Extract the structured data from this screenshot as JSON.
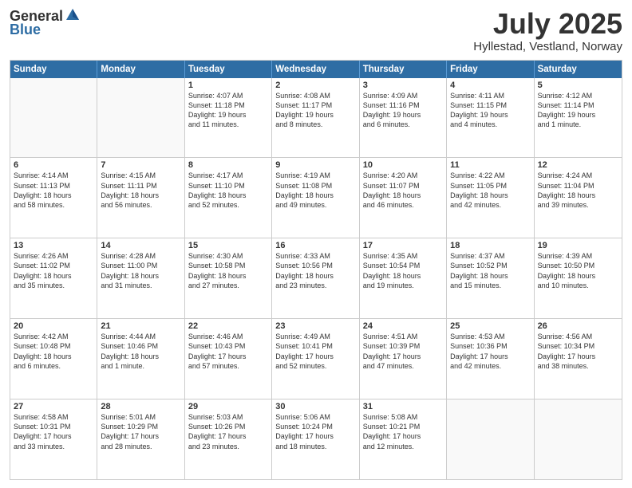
{
  "header": {
    "logo_line1": "General",
    "logo_line2": "Blue",
    "month": "July 2025",
    "location": "Hyllestad, Vestland, Norway"
  },
  "weekdays": [
    "Sunday",
    "Monday",
    "Tuesday",
    "Wednesday",
    "Thursday",
    "Friday",
    "Saturday"
  ],
  "rows": [
    [
      {
        "day": "",
        "text": ""
      },
      {
        "day": "",
        "text": ""
      },
      {
        "day": "1",
        "text": "Sunrise: 4:07 AM\nSunset: 11:18 PM\nDaylight: 19 hours\nand 11 minutes."
      },
      {
        "day": "2",
        "text": "Sunrise: 4:08 AM\nSunset: 11:17 PM\nDaylight: 19 hours\nand 8 minutes."
      },
      {
        "day": "3",
        "text": "Sunrise: 4:09 AM\nSunset: 11:16 PM\nDaylight: 19 hours\nand 6 minutes."
      },
      {
        "day": "4",
        "text": "Sunrise: 4:11 AM\nSunset: 11:15 PM\nDaylight: 19 hours\nand 4 minutes."
      },
      {
        "day": "5",
        "text": "Sunrise: 4:12 AM\nSunset: 11:14 PM\nDaylight: 19 hours\nand 1 minute."
      }
    ],
    [
      {
        "day": "6",
        "text": "Sunrise: 4:14 AM\nSunset: 11:13 PM\nDaylight: 18 hours\nand 58 minutes."
      },
      {
        "day": "7",
        "text": "Sunrise: 4:15 AM\nSunset: 11:11 PM\nDaylight: 18 hours\nand 56 minutes."
      },
      {
        "day": "8",
        "text": "Sunrise: 4:17 AM\nSunset: 11:10 PM\nDaylight: 18 hours\nand 52 minutes."
      },
      {
        "day": "9",
        "text": "Sunrise: 4:19 AM\nSunset: 11:08 PM\nDaylight: 18 hours\nand 49 minutes."
      },
      {
        "day": "10",
        "text": "Sunrise: 4:20 AM\nSunset: 11:07 PM\nDaylight: 18 hours\nand 46 minutes."
      },
      {
        "day": "11",
        "text": "Sunrise: 4:22 AM\nSunset: 11:05 PM\nDaylight: 18 hours\nand 42 minutes."
      },
      {
        "day": "12",
        "text": "Sunrise: 4:24 AM\nSunset: 11:04 PM\nDaylight: 18 hours\nand 39 minutes."
      }
    ],
    [
      {
        "day": "13",
        "text": "Sunrise: 4:26 AM\nSunset: 11:02 PM\nDaylight: 18 hours\nand 35 minutes."
      },
      {
        "day": "14",
        "text": "Sunrise: 4:28 AM\nSunset: 11:00 PM\nDaylight: 18 hours\nand 31 minutes."
      },
      {
        "day": "15",
        "text": "Sunrise: 4:30 AM\nSunset: 10:58 PM\nDaylight: 18 hours\nand 27 minutes."
      },
      {
        "day": "16",
        "text": "Sunrise: 4:33 AM\nSunset: 10:56 PM\nDaylight: 18 hours\nand 23 minutes."
      },
      {
        "day": "17",
        "text": "Sunrise: 4:35 AM\nSunset: 10:54 PM\nDaylight: 18 hours\nand 19 minutes."
      },
      {
        "day": "18",
        "text": "Sunrise: 4:37 AM\nSunset: 10:52 PM\nDaylight: 18 hours\nand 15 minutes."
      },
      {
        "day": "19",
        "text": "Sunrise: 4:39 AM\nSunset: 10:50 PM\nDaylight: 18 hours\nand 10 minutes."
      }
    ],
    [
      {
        "day": "20",
        "text": "Sunrise: 4:42 AM\nSunset: 10:48 PM\nDaylight: 18 hours\nand 6 minutes."
      },
      {
        "day": "21",
        "text": "Sunrise: 4:44 AM\nSunset: 10:46 PM\nDaylight: 18 hours\nand 1 minute."
      },
      {
        "day": "22",
        "text": "Sunrise: 4:46 AM\nSunset: 10:43 PM\nDaylight: 17 hours\nand 57 minutes."
      },
      {
        "day": "23",
        "text": "Sunrise: 4:49 AM\nSunset: 10:41 PM\nDaylight: 17 hours\nand 52 minutes."
      },
      {
        "day": "24",
        "text": "Sunrise: 4:51 AM\nSunset: 10:39 PM\nDaylight: 17 hours\nand 47 minutes."
      },
      {
        "day": "25",
        "text": "Sunrise: 4:53 AM\nSunset: 10:36 PM\nDaylight: 17 hours\nand 42 minutes."
      },
      {
        "day": "26",
        "text": "Sunrise: 4:56 AM\nSunset: 10:34 PM\nDaylight: 17 hours\nand 38 minutes."
      }
    ],
    [
      {
        "day": "27",
        "text": "Sunrise: 4:58 AM\nSunset: 10:31 PM\nDaylight: 17 hours\nand 33 minutes."
      },
      {
        "day": "28",
        "text": "Sunrise: 5:01 AM\nSunset: 10:29 PM\nDaylight: 17 hours\nand 28 minutes."
      },
      {
        "day": "29",
        "text": "Sunrise: 5:03 AM\nSunset: 10:26 PM\nDaylight: 17 hours\nand 23 minutes."
      },
      {
        "day": "30",
        "text": "Sunrise: 5:06 AM\nSunset: 10:24 PM\nDaylight: 17 hours\nand 18 minutes."
      },
      {
        "day": "31",
        "text": "Sunrise: 5:08 AM\nSunset: 10:21 PM\nDaylight: 17 hours\nand 12 minutes."
      },
      {
        "day": "",
        "text": ""
      },
      {
        "day": "",
        "text": ""
      }
    ]
  ]
}
